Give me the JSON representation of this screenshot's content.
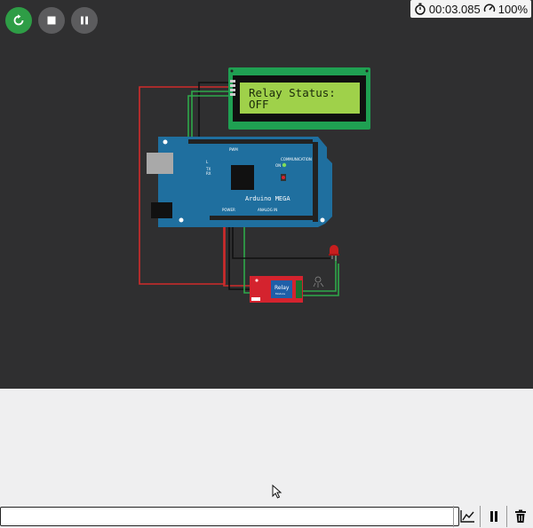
{
  "toolbar": {
    "restart_label": "Restart simulation",
    "stop_label": "Stop simulation",
    "pause_label": "Pause simulation"
  },
  "status": {
    "timer": "00:03.085",
    "speed": "100%"
  },
  "lcd": {
    "line1": "Relay Status:",
    "line2": "OFF"
  },
  "board": {
    "name": "Arduino MEGA",
    "pwm_label": "PWM",
    "communication_label": "COMMUNICATION",
    "power_label": "POWER",
    "analog_label": "ANALOG IN",
    "on_label": "ON",
    "tx_label": "TX",
    "rx_label": "RX",
    "l_label": "L"
  },
  "relay": {
    "label": "Relay",
    "sublabel": "Module"
  },
  "serial": {
    "input_value": "",
    "input_placeholder": ""
  },
  "icons": {
    "restart": "restart-icon",
    "stop": "stop-icon",
    "pause": "pause-icon",
    "timer": "stopwatch-icon",
    "speed": "speedometer-icon",
    "plotter": "chart-line-icon",
    "serial_pause": "pause-icon",
    "clear": "trash-icon"
  },
  "colors": {
    "restart": "#2e9d46",
    "control": "#5c5c5e",
    "canvas": "#2f2f30",
    "board": "#1f6f9f",
    "lcd_frame": "#1fa052",
    "lcd_screen": "#9fd14a",
    "relay": "#d4232e",
    "wire_red": "#d12b2b",
    "wire_black": "#111111",
    "wire_green": "#2ea84a"
  }
}
